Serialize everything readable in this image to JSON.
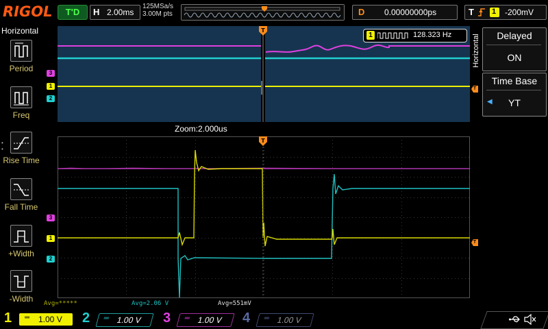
{
  "header": {
    "logo": "RIGOL",
    "trigger_status": "T'D",
    "horizontal": {
      "label": "H",
      "value": "2.00ms"
    },
    "sample_rate": "125MSa/s",
    "memory_depth": "3.00M pts",
    "delay": {
      "label": "D",
      "value": "0.00000000ps"
    },
    "trigger": {
      "label": "T",
      "level": "-200mV"
    }
  },
  "left_menu": {
    "title": "Horizontal",
    "items": [
      {
        "label": "Period",
        "icon": "period-icon"
      },
      {
        "label": "Freq",
        "icon": "freq-icon"
      },
      {
        "label": "Rise Time",
        "icon": "rise-time-icon"
      },
      {
        "label": "Fall Time",
        "icon": "fall-time-icon"
      },
      {
        "label": "+Width",
        "icon": "pos-width-icon"
      },
      {
        "label": "-Width",
        "icon": "neg-width-icon"
      }
    ]
  },
  "right_menu": {
    "side_label": "Horizontal",
    "delayed": {
      "title": "Delayed",
      "value": "ON"
    },
    "timebase": {
      "title": "Time Base",
      "value": "YT"
    }
  },
  "overview": {
    "freq_badge": {
      "channel": "1",
      "value": "128.323 Hz"
    },
    "markers": [
      "3",
      "1",
      "2"
    ]
  },
  "zoom": {
    "label": "Zoom:2.000us",
    "markers": [
      "3",
      "1",
      "2"
    ]
  },
  "measurements": [
    {
      "text": "Avg=*****",
      "color": "#b0b000"
    },
    {
      "text": "Avg=2.06 V",
      "color": "#20c0c0"
    },
    {
      "text": "Avg=551mV",
      "color": "#e0e0e0"
    }
  ],
  "channels": [
    {
      "num": "1",
      "scale": "1.00 V",
      "color": "#f0f000",
      "active": true
    },
    {
      "num": "2",
      "scale": "1.00 V",
      "color": "#20d0d0",
      "active": false
    },
    {
      "num": "3",
      "scale": "1.00 V",
      "color": "#e040e0",
      "active": false
    },
    {
      "num": "4",
      "scale": "1.00 V",
      "color": "#4060c0",
      "active": false
    }
  ],
  "colors": {
    "ch1": "#f0f000",
    "ch2": "#20d0d0",
    "ch3": "#e040e0",
    "trigger": "#ff8c1a",
    "overview_bg": "#16344f",
    "brand": "#ff5a14"
  },
  "icons": {
    "usb": "usb-icon",
    "sound": "speaker-muted-icon"
  }
}
